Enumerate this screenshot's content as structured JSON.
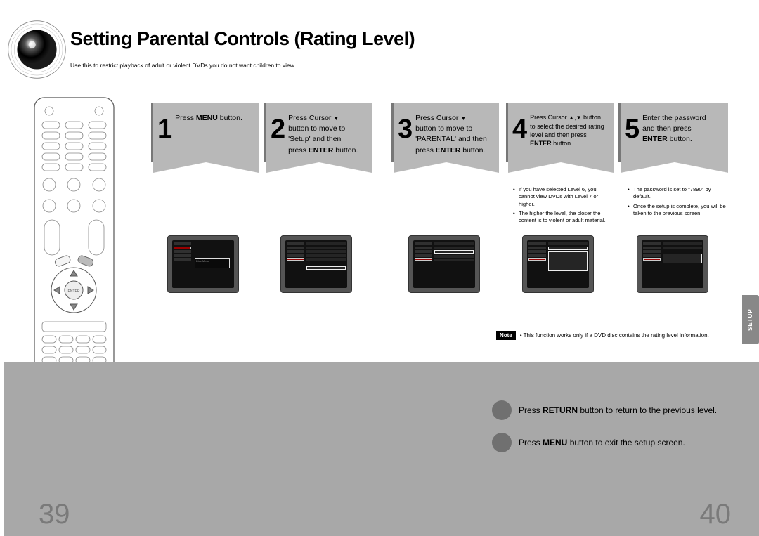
{
  "title": "Setting Parental Controls (Rating Level)",
  "subtitle": "Use this to restrict playback of adult or violent DVDs you do not want children to view.",
  "steps": {
    "s1": {
      "n": "1",
      "text_html": "Press <b>MENU</b> button."
    },
    "s2": {
      "n": "2",
      "text_html": "Press Cursor <span class='tri'>▼</span><br>button to move to<br>'Setup' and then<br>press <b>ENTER</b> button."
    },
    "s3": {
      "n": "3",
      "text_html": "Press Cursor <span class='tri'>▼</span><br>button to move to<br>'PARENTAL' and then<br>press <b>ENTER</b> button."
    },
    "s4": {
      "n": "4",
      "text_html": "Press Cursor <span class='tri'>▲</span>,<span class='tri'>▼</span> button<br>to select the desired rating<br>level and then press<br><b>ENTER</b> button."
    },
    "s5": {
      "n": "5",
      "text_html": "Enter the password<br>and then press<br><b>ENTER</b> button."
    }
  },
  "bullets4": [
    "If you have selected Level 6, you cannot view DVDs with Level 7 or higher.",
    "The higher the level, the closer the content is to violent or adult material."
  ],
  "bullets5": [
    "The password is set to \"7890\" by default.",
    "Once the setup is complete, you will be taken to the previous screen."
  ],
  "note": {
    "label": "Note",
    "text": "This function works only if a DVD disc contains the rating level information."
  },
  "footer": {
    "line1_html": "Press <b>RETURN</b> button to return to the previous level.",
    "line2_html": "Press <b>MENU</b> button to exit the setup screen."
  },
  "page_left": "39",
  "page_right": "40",
  "side_tab": "SETUP"
}
